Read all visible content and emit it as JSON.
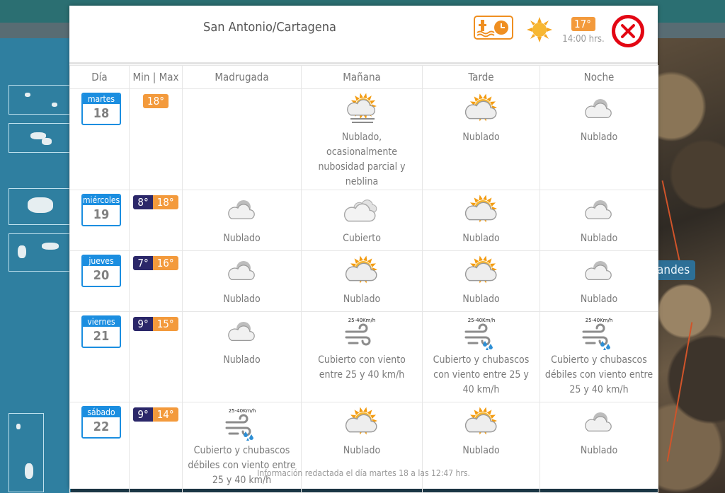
{
  "map": {
    "label": "andes"
  },
  "modal": {
    "title": "San Antonio/Cartagena",
    "current": {
      "temp": "17°",
      "time": "14:00 hrs."
    },
    "columns": [
      "Día",
      "Min | Max",
      "Madrugada",
      "Mañana",
      "Tarde",
      "Noche"
    ],
    "days": [
      {
        "name": "martes",
        "num": "18",
        "min": "",
        "max": "18°",
        "periods": [
          {
            "icon": "",
            "desc": ""
          },
          {
            "icon": "fog-cloud-sun",
            "desc": "Nublado, ocasionalmente nubosidad parcial y neblina"
          },
          {
            "icon": "sun-cloud",
            "desc": "Nublado"
          },
          {
            "icon": "moon-cloud",
            "desc": "Nublado"
          }
        ]
      },
      {
        "name": "miércoles",
        "num": "19",
        "min": "8°",
        "max": "18°",
        "periods": [
          {
            "icon": "moon-cloud",
            "desc": "Nublado"
          },
          {
            "icon": "overcast",
            "desc": "Cubierto"
          },
          {
            "icon": "sun-cloud",
            "desc": "Nublado"
          },
          {
            "icon": "moon-cloud",
            "desc": "Nublado"
          }
        ]
      },
      {
        "name": "jueves",
        "num": "20",
        "min": "7°",
        "max": "16°",
        "periods": [
          {
            "icon": "moon-cloud",
            "desc": "Nublado"
          },
          {
            "icon": "sun-cloud",
            "desc": "Nublado"
          },
          {
            "icon": "sun-cloud",
            "desc": "Nublado"
          },
          {
            "icon": "moon-cloud",
            "desc": "Nublado"
          }
        ]
      },
      {
        "name": "viernes",
        "num": "21",
        "min": "9°",
        "max": "15°",
        "periods": [
          {
            "icon": "moon-cloud",
            "desc": "Nublado"
          },
          {
            "icon": "wind",
            "wind": "25-40Km/h",
            "desc": "Cubierto con viento entre 25 y 40 km/h"
          },
          {
            "icon": "wind-showers",
            "wind": "25-40Km/h",
            "desc": "Cubierto y chubascos con viento entre 25 y 40 km/h"
          },
          {
            "icon": "wind-showers",
            "wind": "25-40Km/h",
            "desc": "Cubierto y chubascos débiles con viento entre 25 y 40 km/h"
          }
        ]
      },
      {
        "name": "sábado",
        "num": "22",
        "min": "9°",
        "max": "14°",
        "periods": [
          {
            "icon": "wind-showers",
            "wind": "25-40Km/h",
            "desc": "Cubierto y chubascos débiles con viento entre 25 y 40 km/h"
          },
          {
            "icon": "sun-cloud",
            "desc": "Nublado"
          },
          {
            "icon": "sun-cloud",
            "desc": "Nublado"
          },
          {
            "icon": "moon-cloud",
            "desc": "Nublado"
          }
        ]
      }
    ],
    "footer": "Información redactada el día martes 18 a las 12:47 hrs.",
    "colors": {
      "accent_orange": "#f39a3c",
      "min_temp_bg": "#2b2769",
      "calendar_blue": "#1b8ee0",
      "close_red": "#e30613"
    }
  }
}
